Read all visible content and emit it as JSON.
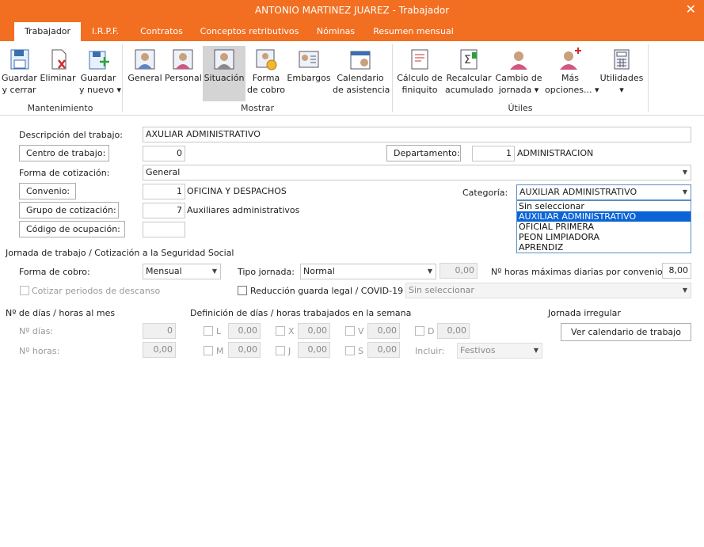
{
  "window": {
    "title": "ANTONIO MARTINEZ JUAREZ - Trabajador",
    "close": "✕"
  },
  "tabs": [
    "Trabajador",
    "I.R.P.F.",
    "Contratos",
    "Conceptos retributivos",
    "Nóminas",
    "Resumen mensual"
  ],
  "ribbon": {
    "buttons": {
      "guardar_cerrar": "Guardar\ny cerrar",
      "eliminar": "Eliminar",
      "guardar_nuevo": "Guardar\ny nuevo ▾",
      "general": "General",
      "personal": "Personal",
      "situacion": "Situación",
      "forma_cobro": "Forma\nde cobro",
      "embargos": "Embargos",
      "calendario": "Calendario\nde asistencia",
      "finiquito": "Cálculo de\nfiniquito",
      "recalcular": "Recalcular\nacumulado",
      "cambio_jornada": "Cambio de\njornada ▾",
      "mas_opciones": "Más\nopciones... ▾",
      "utilidades": "Utilidades\n▾"
    },
    "groups": {
      "mantenimiento": "Mantenimiento",
      "mostrar": "Mostrar",
      "utiles": "Útiles"
    }
  },
  "form": {
    "descripcion_label": "Descripción del trabajo:",
    "descripcion_value": "AXULIAR ADMINISTRATIVO",
    "centro_button": "Centro de trabajo:",
    "centro_value": "0",
    "departamento_button": "Departamento:",
    "departamento_value": "1",
    "departamento_name": "ADMINISTRACION",
    "forma_cotizacion_label": "Forma de cotización:",
    "forma_cotizacion_value": "General",
    "convenio_button": "Convenio:",
    "convenio_value": "1",
    "convenio_name": "OFICINA Y DESPACHOS",
    "categoria_label": "Categoría:",
    "categoria_value": "AUXILIAR ADMINISTRATIVO",
    "categoria_options": [
      "Sin seleccionar",
      "AUXILIAR ADMINISTRATIVO",
      "OFICIAL PRIMERA",
      "PEON LIMPIADORA",
      "APRENDIZ"
    ],
    "grupo_button": "Grupo de cotización:",
    "grupo_value": "7",
    "grupo_name": "Auxiliares administrativos",
    "codigo_button": "Código de ocupación:",
    "codigo_value": ""
  },
  "jornada": {
    "section_title": "Jornada de trabajo / Cotización a la Seguridad Social",
    "forma_cobro_label": "Forma de cobro:",
    "forma_cobro_value": "Mensual",
    "tipo_jornada_label": "Tipo jornada:",
    "tipo_jornada_value": "Normal",
    "tipo_jornada_pct": "0,00",
    "horas_max_label": "Nº horas máximas diarias por convenio:",
    "horas_max_value": "8,00",
    "cotizar_label": "Cotizar periodos de descanso",
    "reduccion_label": "Reducción guarda legal / COVID-19",
    "reduccion_value": "Sin seleccionar"
  },
  "dias": {
    "title": "Nº de días / horas al mes",
    "dias_label": "Nº días:",
    "dias_value": "0",
    "horas_label": "Nº horas:",
    "horas_value": "0,00",
    "semana_title": "Definición de días / horas trabajados en la semana",
    "days": [
      {
        "letter": "L",
        "value": "0,00"
      },
      {
        "letter": "X",
        "value": "0,00"
      },
      {
        "letter": "V",
        "value": "0,00"
      },
      {
        "letter": "D",
        "value": "0,00"
      },
      {
        "letter": "M",
        "value": "0,00"
      },
      {
        "letter": "J",
        "value": "0,00"
      },
      {
        "letter": "S",
        "value": "0,00"
      }
    ],
    "incluir_label": "Incluir:",
    "incluir_value": "Festivos",
    "irregular_title": "Jornada irregular",
    "calendario_button": "Ver calendario de trabajo"
  },
  "colors": {
    "accent": "#f26f21",
    "selection": "#0a64d6"
  }
}
